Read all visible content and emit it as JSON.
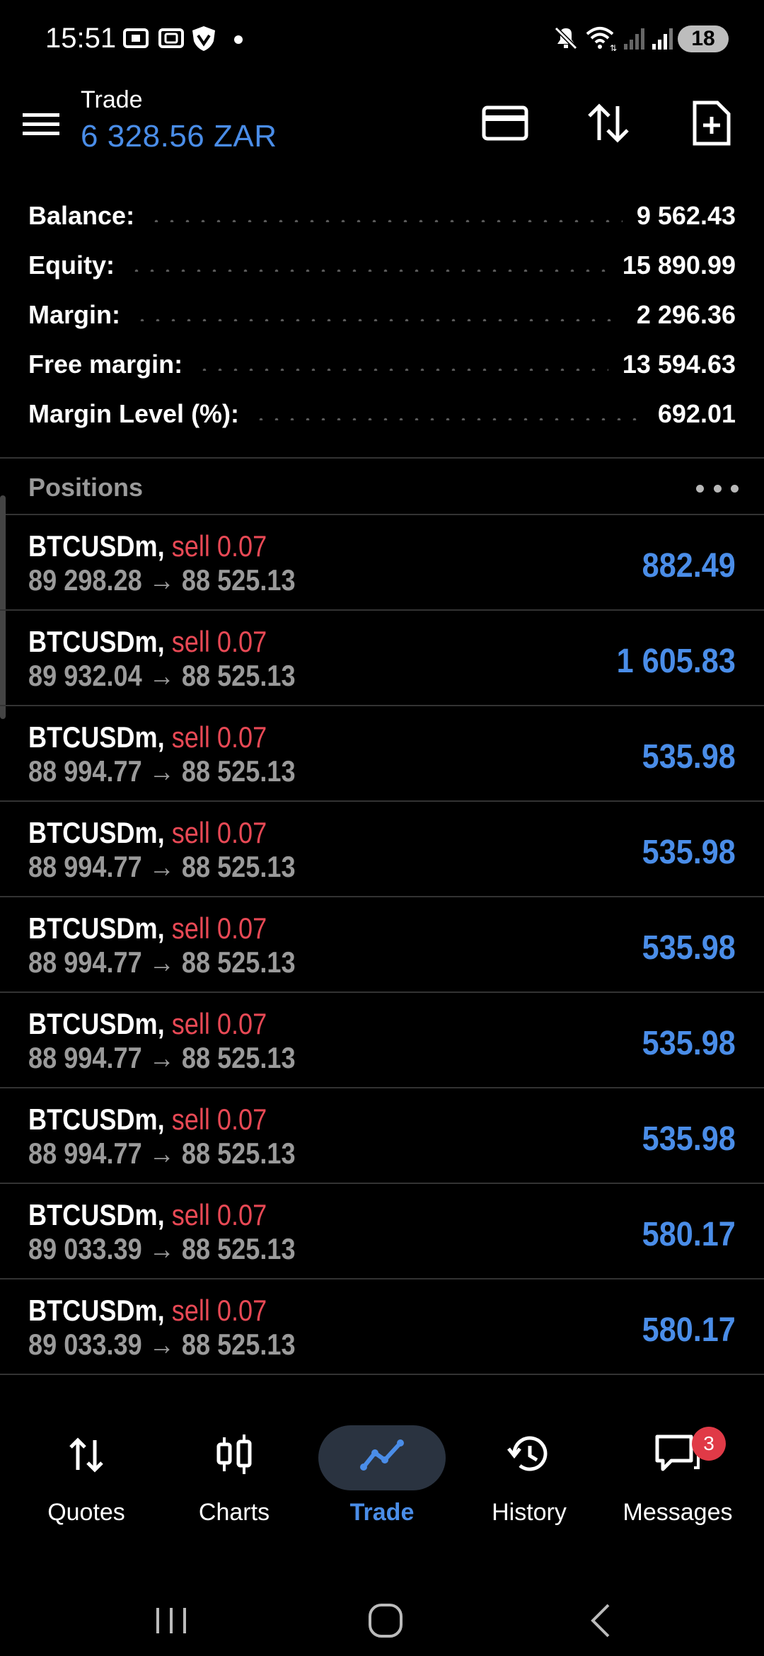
{
  "status": {
    "time": "15:51",
    "battery": "18"
  },
  "header": {
    "title": "Trade",
    "balance_display": "6 328.56 ZAR"
  },
  "summary": [
    {
      "label": "Balance:",
      "value": "9 562.43"
    },
    {
      "label": "Equity:",
      "value": "15 890.99"
    },
    {
      "label": "Margin:",
      "value": "2 296.36"
    },
    {
      "label": "Free margin:",
      "value": "13 594.63"
    },
    {
      "label": "Margin Level (%):",
      "value": "692.01"
    }
  ],
  "positions": {
    "title": "Positions",
    "items": [
      {
        "symbol": "BTCUSDm,",
        "direction": "sell 0.07",
        "prices": "89 298.28 → 88 525.13",
        "profit": "882.49"
      },
      {
        "symbol": "BTCUSDm,",
        "direction": "sell 0.07",
        "prices": "89 932.04 → 88 525.13",
        "profit": "1 605.83"
      },
      {
        "symbol": "BTCUSDm,",
        "direction": "sell 0.07",
        "prices": "88 994.77 → 88 525.13",
        "profit": "535.98"
      },
      {
        "symbol": "BTCUSDm,",
        "direction": "sell 0.07",
        "prices": "88 994.77 → 88 525.13",
        "profit": "535.98"
      },
      {
        "symbol": "BTCUSDm,",
        "direction": "sell 0.07",
        "prices": "88 994.77 → 88 525.13",
        "profit": "535.98"
      },
      {
        "symbol": "BTCUSDm,",
        "direction": "sell 0.07",
        "prices": "88 994.77 → 88 525.13",
        "profit": "535.98"
      },
      {
        "symbol": "BTCUSDm,",
        "direction": "sell 0.07",
        "prices": "88 994.77 → 88 525.13",
        "profit": "535.98"
      },
      {
        "symbol": "BTCUSDm,",
        "direction": "sell 0.07",
        "prices": "89 033.39 → 88 525.13",
        "profit": "580.17"
      },
      {
        "symbol": "BTCUSDm,",
        "direction": "sell 0.07",
        "prices": "89 033.39 → 88 525.13",
        "profit": "580.17"
      }
    ]
  },
  "nav": [
    {
      "label": "Quotes",
      "icon": "quotes-icon"
    },
    {
      "label": "Charts",
      "icon": "charts-icon"
    },
    {
      "label": "Trade",
      "icon": "trade-icon",
      "active": true
    },
    {
      "label": "History",
      "icon": "history-icon"
    },
    {
      "label": "Messages",
      "icon": "messages-icon",
      "badge": "3"
    }
  ],
  "colors": {
    "accent": "#4a8de8",
    "sell": "#e84955",
    "muted": "#9a9a9a",
    "background": "#000000"
  }
}
